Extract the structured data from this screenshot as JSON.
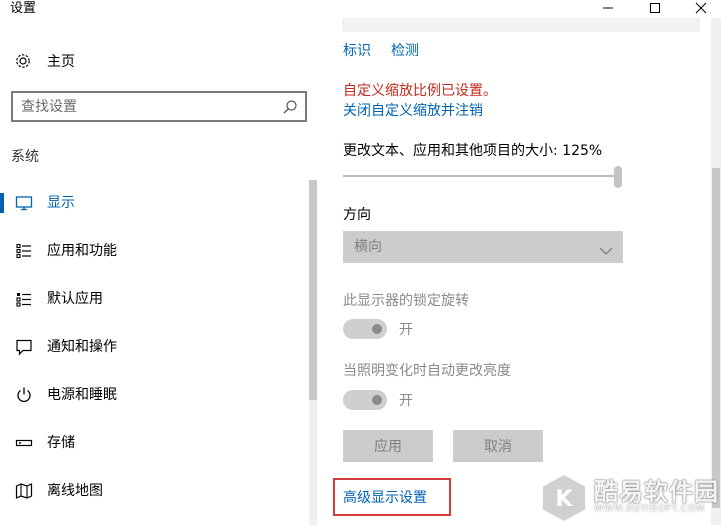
{
  "window": {
    "title": "设置"
  },
  "sidebar": {
    "home_label": "主页",
    "search_placeholder": "查找设置",
    "section_label": "系统",
    "items": [
      {
        "label": "显示",
        "icon": "monitor-icon",
        "active": true
      },
      {
        "label": "应用和功能",
        "icon": "apps-list-icon",
        "active": false
      },
      {
        "label": "默认应用",
        "icon": "default-apps-icon",
        "active": false
      },
      {
        "label": "通知和操作",
        "icon": "notification-icon",
        "active": false
      },
      {
        "label": "电源和睡眠",
        "icon": "power-icon",
        "active": false
      },
      {
        "label": "存储",
        "icon": "storage-icon",
        "active": false
      },
      {
        "label": "离线地图",
        "icon": "map-icon",
        "active": false
      }
    ]
  },
  "content": {
    "links": [
      "标识",
      "检测"
    ],
    "custom_scale_warning": "自定义缩放比例已设置。",
    "signout_link": "关闭自定义缩放并注销",
    "scale_label": "更改文本、应用和其他项目的大小: 125%",
    "scale_slider_position": 1.0,
    "orientation_label": "方向",
    "orientation_value": "横向",
    "rotation_lock_label": "此显示器的锁定旋转",
    "rotation_lock_state": "开",
    "auto_brightness_label": "当照明变化时自动更改亮度",
    "auto_brightness_state": "开",
    "apply_button": "应用",
    "cancel_button": "取消",
    "advanced_link": "高级显示设置"
  },
  "watermark": {
    "letter": "K",
    "brand": "酷易软件园",
    "url": "WWW.KUYISOFT.COM"
  },
  "colors": {
    "accent": "#0063b1",
    "warning": "#c42b1c",
    "highlight_box": "#d43b3b"
  }
}
